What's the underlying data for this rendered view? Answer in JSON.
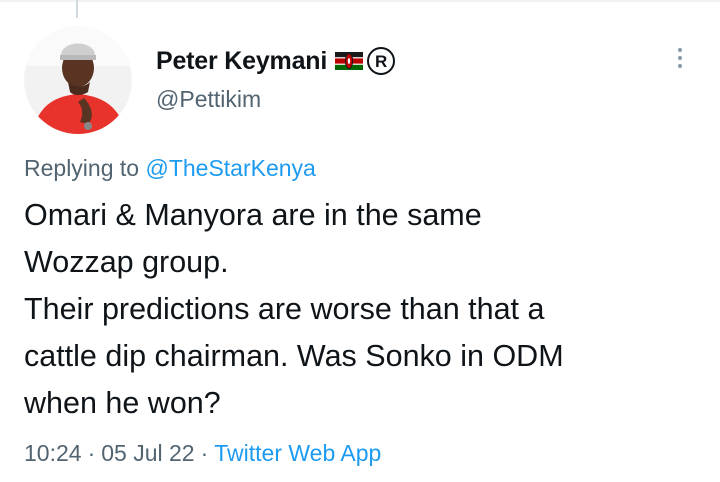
{
  "tweet": {
    "author": {
      "display_name": "Peter Keymani",
      "handle": "@Pettikim",
      "avatar_icon": "profile-photo-icon",
      "badges": [
        "kenya-flag-icon",
        "registered-mark-icon"
      ],
      "registered_mark": "R"
    },
    "reply": {
      "prefix": "Replying to",
      "mention": "@TheStarKenya"
    },
    "text_lines": [
      "Omari & Manyora are in the same",
      "Wozzap group.",
      "Their predictions are worse than that a",
      "cattle dip chairman. Was Sonko in ODM",
      "when he won?"
    ],
    "time": "10:24",
    "date": "05 Jul 22",
    "separator": "·",
    "source": "Twitter Web App"
  },
  "colors": {
    "text": "#0f1419",
    "secondary": "#536471",
    "link": "#1d9bf0"
  }
}
